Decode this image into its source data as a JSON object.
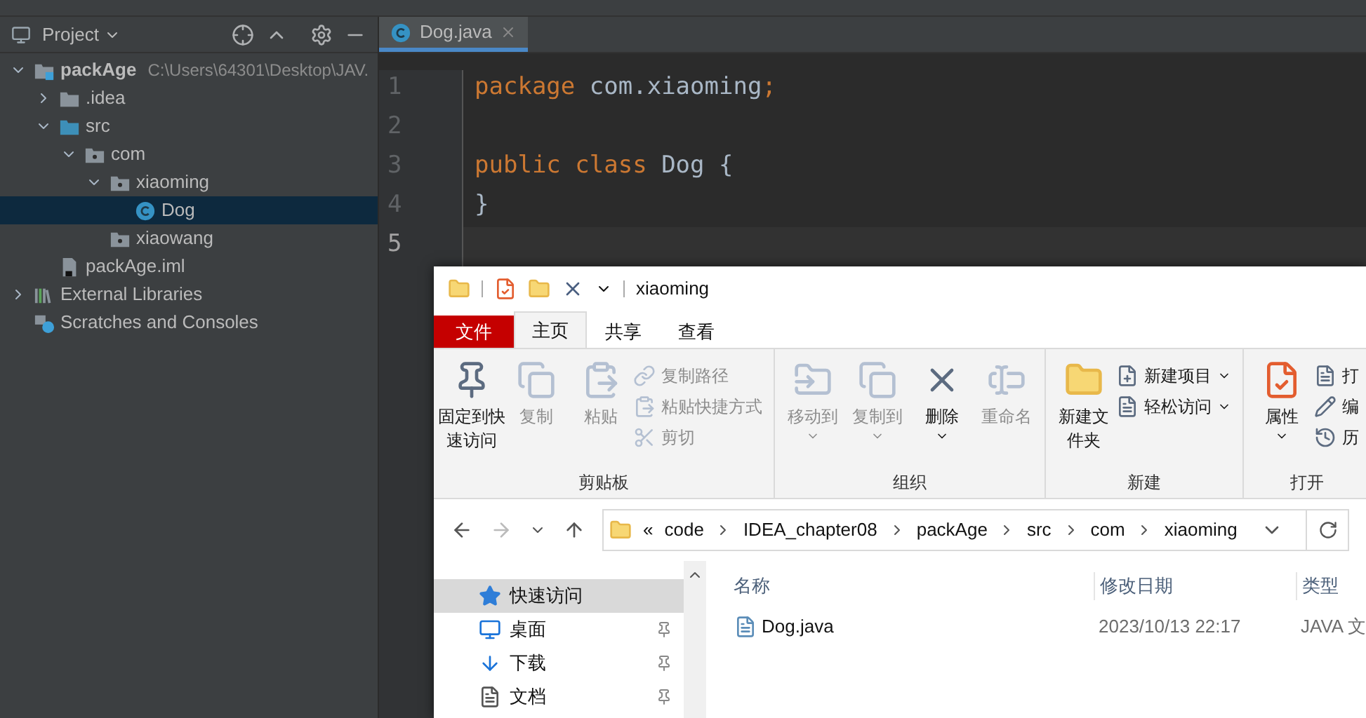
{
  "project_panel": {
    "title": "Project",
    "tree": [
      {
        "label": "packAge",
        "path": "C:\\Users\\64301\\Desktop\\JAV.",
        "kind": "module",
        "expanded": true,
        "selected": false,
        "children": [
          {
            "label": ".idea",
            "kind": "folder",
            "expanded": false,
            "selected": false
          },
          {
            "label": "src",
            "kind": "source",
            "expanded": true,
            "selected": false,
            "children": [
              {
                "label": "com",
                "kind": "package",
                "expanded": true,
                "selected": false,
                "children": [
                  {
                    "label": "xiaoming",
                    "kind": "package",
                    "expanded": true,
                    "selected": false,
                    "children": [
                      {
                        "label": "Dog",
                        "kind": "class",
                        "selected": true
                      }
                    ]
                  },
                  {
                    "label": "xiaowang",
                    "kind": "package",
                    "selected": false
                  }
                ]
              }
            ]
          },
          {
            "label": "packAge.iml",
            "kind": "file",
            "selected": false
          }
        ]
      },
      {
        "label": "External Libraries",
        "kind": "libraries",
        "expanded": false,
        "selected": false
      },
      {
        "label": "Scratches and Consoles",
        "kind": "scratches",
        "selected": false
      }
    ]
  },
  "editor": {
    "tabs": [
      {
        "label": "Dog.java",
        "selected": true
      }
    ],
    "lines": [
      {
        "number": "1",
        "current": false,
        "tokens": [
          {
            "kind": "keyword",
            "text": "package"
          },
          {
            "kind": "plain",
            "text": " com.xiaoming"
          },
          {
            "kind": "keyword",
            "text": ";"
          }
        ]
      },
      {
        "number": "2",
        "current": false
      },
      {
        "number": "3",
        "current": false,
        "tokens": [
          {
            "kind": "keyword",
            "text": "public class "
          },
          {
            "kind": "ident",
            "text": "Dog"
          },
          {
            "kind": "plain",
            "text": " {"
          }
        ]
      },
      {
        "number": "4",
        "current": false,
        "tokens": [
          {
            "kind": "plain",
            "text": "}"
          }
        ]
      },
      {
        "number": "5",
        "current": true
      }
    ]
  },
  "explorer": {
    "title": "xiaoming",
    "ribbon_tabs": [
      {
        "label": "文件",
        "kind": "file",
        "selected": false
      },
      {
        "label": "主页",
        "kind": "tab",
        "selected": true
      },
      {
        "label": "共享",
        "kind": "tab",
        "selected": false
      },
      {
        "label": "查看",
        "kind": "tab",
        "selected": false
      }
    ],
    "groups": [
      {
        "label": "剪贴板",
        "commands": [
          {
            "label": "固定到快速访问",
            "kind": "large",
            "disabled": false,
            "dropdown": false
          },
          {
            "label": "复制",
            "kind": "large",
            "disabled": true,
            "dropdown": false
          },
          {
            "label": "粘贴",
            "kind": "large",
            "disabled": true,
            "dropdown": false
          },
          {
            "label": "复制路径",
            "kind": "small",
            "disabled": true,
            "dropdown": false
          },
          {
            "label": "粘贴快捷方式",
            "kind": "small",
            "disabled": true,
            "dropdown": false
          },
          {
            "label": "剪切",
            "kind": "small",
            "disabled": true,
            "dropdown": false
          }
        ]
      },
      {
        "label": "组织",
        "commands": [
          {
            "label": "移动到",
            "kind": "large",
            "disabled": true,
            "dropdown": true
          },
          {
            "label": "复制到",
            "kind": "large",
            "disabled": true,
            "dropdown": true
          },
          {
            "label": "删除",
            "kind": "large",
            "disabled": false,
            "dropdown": true
          },
          {
            "label": "重命名",
            "kind": "large",
            "disabled": true,
            "dropdown": false
          }
        ]
      },
      {
        "label": "新建",
        "commands": [
          {
            "label": "新建文件夹",
            "kind": "large",
            "disabled": false,
            "dropdown": false
          },
          {
            "label": "新建项目",
            "kind": "small",
            "disabled": false,
            "dropdown": true
          },
          {
            "label": "轻松访问",
            "kind": "small",
            "disabled": false,
            "dropdown": true
          }
        ]
      },
      {
        "label": "打开",
        "commands": [
          {
            "label": "属性",
            "kind": "large",
            "disabled": false,
            "dropdown": true
          },
          {
            "label": "打",
            "kind": "small"
          },
          {
            "label": "编",
            "kind": "small"
          },
          {
            "label": "历",
            "kind": "small"
          }
        ]
      }
    ],
    "breadcrumb": [
      "«",
      "code",
      "IDEA_chapter08",
      "packAge",
      "src",
      "com",
      "xiaoming"
    ],
    "nav_items": [
      {
        "label": "快速访问",
        "pinned": false,
        "selected": true
      },
      {
        "label": "桌面",
        "pinned": true,
        "selected": false
      },
      {
        "label": "下载",
        "pinned": true,
        "selected": false
      },
      {
        "label": "文档",
        "pinned": true,
        "selected": false
      }
    ],
    "columns": [
      "名称",
      "修改日期",
      "类型"
    ],
    "files": [
      {
        "name": "Dog.java",
        "modified": "2023/10/13 22:17",
        "type": "JAVA 文"
      }
    ]
  }
}
